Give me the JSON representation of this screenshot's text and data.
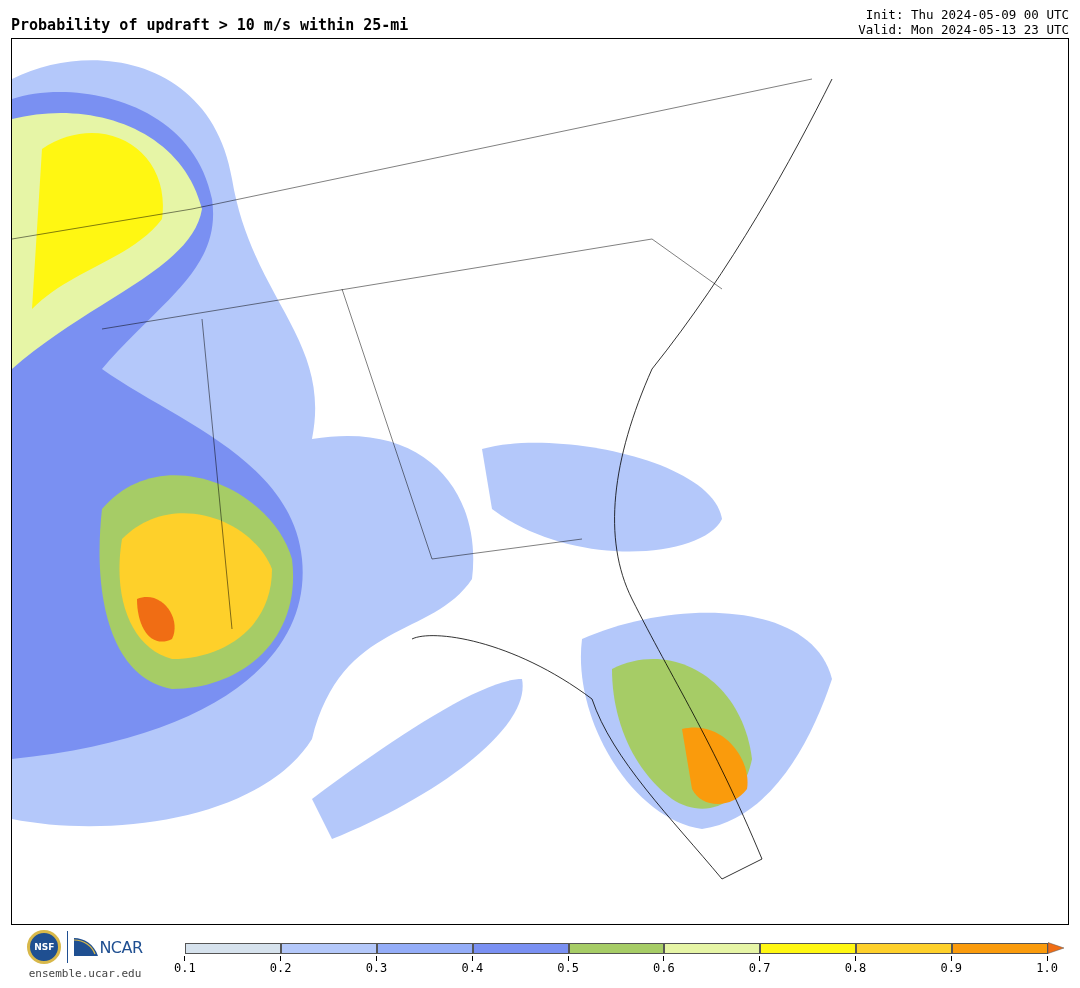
{
  "title": "Probability of updraft > 10 m/s within 25-mi",
  "init": "Init: Thu 2024-05-09 00 UTC",
  "valid": "Valid: Mon 2024-05-13 23 UTC",
  "logos": {
    "nsf": "NSF",
    "ncar": "NCAR",
    "site": "ensemble.ucar.edu"
  },
  "colorbar": {
    "bins": [
      {
        "color": "#d6e2ed"
      },
      {
        "color": "#b4c8fa"
      },
      {
        "color": "#94adf8"
      },
      {
        "color": "#7a90f2"
      },
      {
        "color": "#a6cc66"
      },
      {
        "color": "#e6f5a6"
      },
      {
        "color": "#fff712"
      },
      {
        "color": "#fed02a"
      },
      {
        "color": "#fa9b0c"
      },
      {
        "color": "#f06d14",
        "kind": "arrow"
      }
    ],
    "ticks": [
      "0.1",
      "0.2",
      "0.3",
      "0.4",
      "0.5",
      "0.6",
      "0.7",
      "0.8",
      "0.9",
      "1.0"
    ]
  }
}
